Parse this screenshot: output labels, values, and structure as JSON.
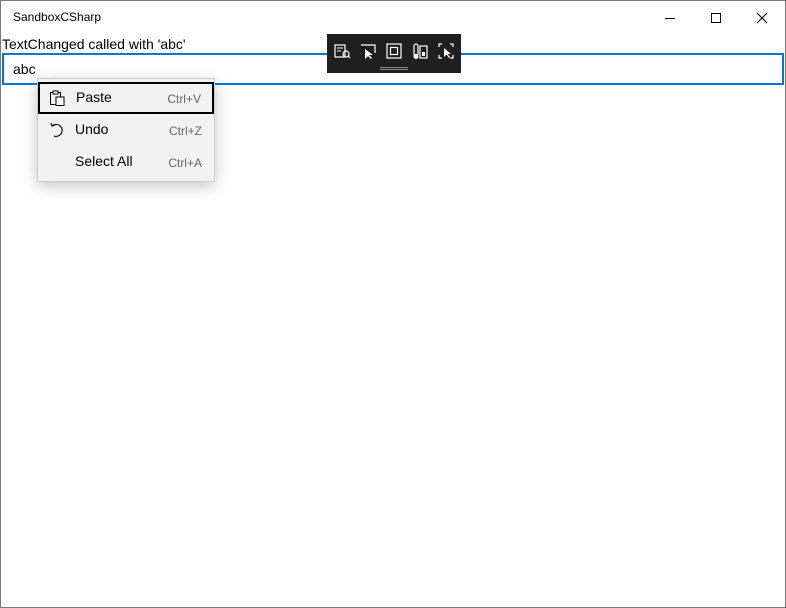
{
  "window": {
    "title": "SandboxCSharp",
    "minimize_icon": "minimize-icon",
    "maximize_icon": "maximize-icon",
    "close_icon": "close-icon"
  },
  "status_text": "TextChanged called with 'abc'",
  "textbox": {
    "value": "abc",
    "focus_color": "#0078d7"
  },
  "debug_toolbar": {
    "icons": [
      "live-visual-tree-icon",
      "select-element-icon",
      "display-layout-adorners-icon",
      "track-focus-icon",
      "preview-selection-icon"
    ]
  },
  "context_menu": {
    "items": [
      {
        "label": "Paste",
        "shortcut": "Ctrl+V",
        "icon": "clipboard-paste-icon",
        "focused": true
      },
      {
        "label": "Undo",
        "shortcut": "Ctrl+Z",
        "icon": "undo-icon",
        "focused": false
      },
      {
        "label": "Select All",
        "shortcut": "Ctrl+A",
        "icon": "",
        "focused": false
      }
    ]
  }
}
